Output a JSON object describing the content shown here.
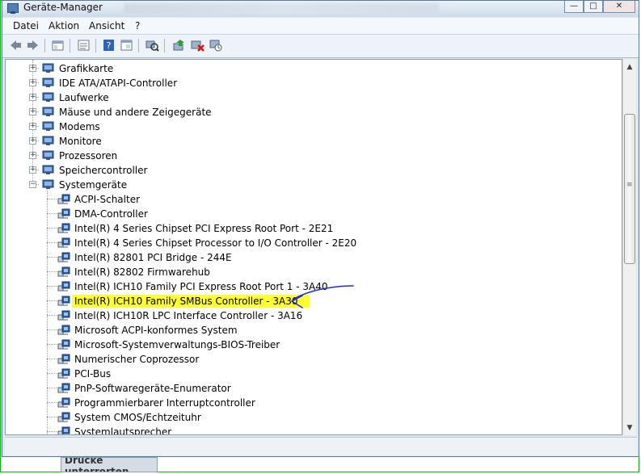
{
  "window": {
    "title": "Geräte-Manager"
  },
  "title_buttons": {
    "minimize": "—",
    "maximize": "□",
    "close": "✕"
  },
  "menu": [
    "Datei",
    "Aktion",
    "Ansicht",
    "?"
  ],
  "toolbar_icons": [
    "back-icon",
    "forward-icon",
    "show-hide-tree-icon",
    "properties-icon",
    "help-icon",
    "view-icon",
    "scan-hardware-icon",
    "update-driver-icon",
    "uninstall-icon",
    "disable-icon"
  ],
  "tree": {
    "categories": [
      {
        "label": "Grafikkarte",
        "icon": "display-adapter-icon"
      },
      {
        "label": "IDE ATA/ATAPI-Controller",
        "icon": "ide-controller-icon"
      },
      {
        "label": "Laufwerke",
        "icon": "disk-drive-icon"
      },
      {
        "label": "Mäuse und andere Zeigegeräte",
        "icon": "mouse-icon"
      },
      {
        "label": "Modems",
        "icon": "modem-icon"
      },
      {
        "label": "Monitore",
        "icon": "monitor-icon"
      },
      {
        "label": "Prozessoren",
        "icon": "processor-icon"
      },
      {
        "label": "Speichercontroller",
        "icon": "storage-controller-icon"
      },
      {
        "label": "Systemgeräte",
        "icon": "system-devices-icon",
        "expanded": true
      }
    ],
    "system_devices": [
      "ACPI-Schalter",
      "DMA-Controller",
      "Intel(R) 4 Series Chipset PCI Express Root Port - 2E21",
      "Intel(R) 4 Series Chipset Processor to I/O Controller - 2E20",
      "Intel(R) 82801 PCI Bridge - 244E",
      "Intel(R) 82802 Firmwarehub",
      "Intel(R) ICH10 Family PCI Express Root Port 1 - 3A40",
      "Intel(R) ICH10 Family SMBus Controller - 3A30",
      "Intel(R) ICH10R LPC Interface Controller - 3A16",
      "Microsoft ACPI-konformes System",
      "Microsoft-Systemverwaltungs-BIOS-Treiber",
      "Numerischer Coprozessor",
      "PCI-Bus",
      "PnP-Softwaregeräte-Enumerator",
      "Programmierbarer Interruptcontroller",
      "System CMOS/Echtzeituhr",
      "Systemlautsprecher"
    ],
    "highlighted_index": 7
  },
  "annotation": {
    "color": "#1a2fd6"
  },
  "taskbar_fragment": "Drucke unterrorten",
  "colors": {
    "highlight": "#ffff33",
    "frame": "#00c000"
  }
}
